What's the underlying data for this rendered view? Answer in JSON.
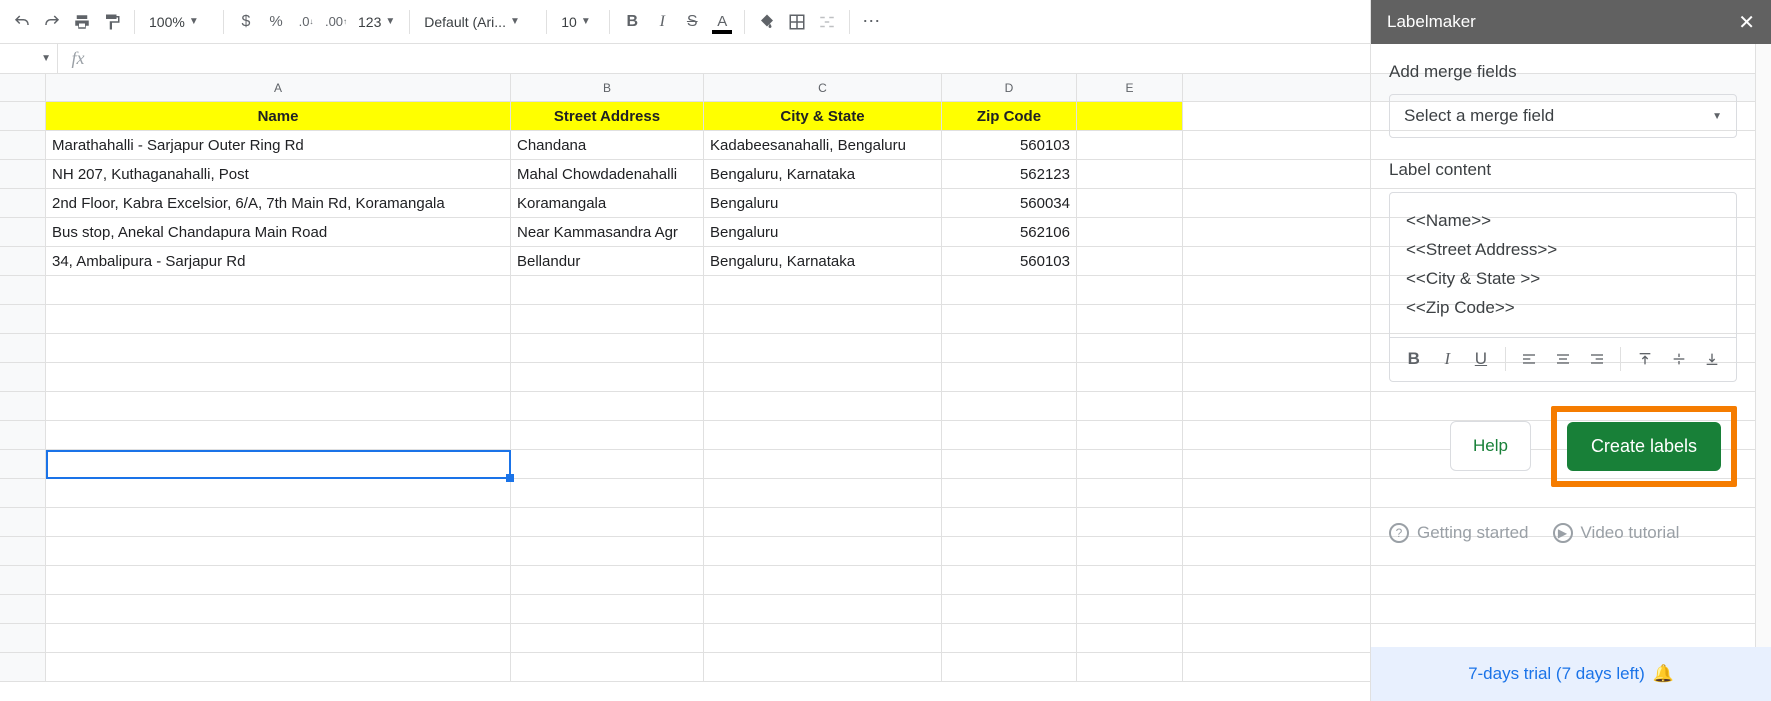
{
  "toolbar": {
    "zoom": "100%",
    "font": "Default (Ari...",
    "font_size": "10",
    "more_formats": "123"
  },
  "columns": [
    "A",
    "B",
    "C",
    "D",
    "E"
  ],
  "headers": {
    "a": "Name",
    "b": "Street Address",
    "c": "City & State",
    "d": "Zip Code"
  },
  "rows": [
    {
      "a": "Marathahalli - Sarjapur Outer Ring Rd",
      "b": "Chandana",
      "c": "Kadabeesanahalli, Bengaluru",
      "d": "560103"
    },
    {
      "a": "NH 207, Kuthaganahalli, Post",
      "b": "Mahal Chowdadenahalli",
      "c": "Bengaluru, Karnataka",
      "d": "562123"
    },
    {
      "a": "2nd Floor, Kabra Excelsior, 6/A, 7th Main Rd, Koramangala",
      "b": "Koramangala",
      "c": "Bengaluru",
      "d": "560034"
    },
    {
      "a": "Bus stop, Anekal Chandapura Main Road",
      "b": "Near Kammasandra Agr",
      "c": "Bengaluru",
      "d": "562106"
    },
    {
      "a": "34, Ambalipura - Sarjapur Rd",
      "b": "Bellandur",
      "c": "Bengaluru, Karnataka",
      "d": "560103"
    }
  ],
  "sidebar": {
    "title": "Labelmaker",
    "add_fields": "Add merge fields",
    "select_placeholder": "Select a merge field",
    "label_content": "Label content",
    "editor_lines": [
      "<<Name>>",
      "<<Street Address>>",
      "<<City & State >>",
      "<<Zip Code>>"
    ],
    "help": "Help",
    "create": "Create labels",
    "getting_started": "Getting started",
    "video_tutorial": "Video tutorial",
    "trial": "7-days trial (7 days left)"
  },
  "formula_fx": "fx"
}
